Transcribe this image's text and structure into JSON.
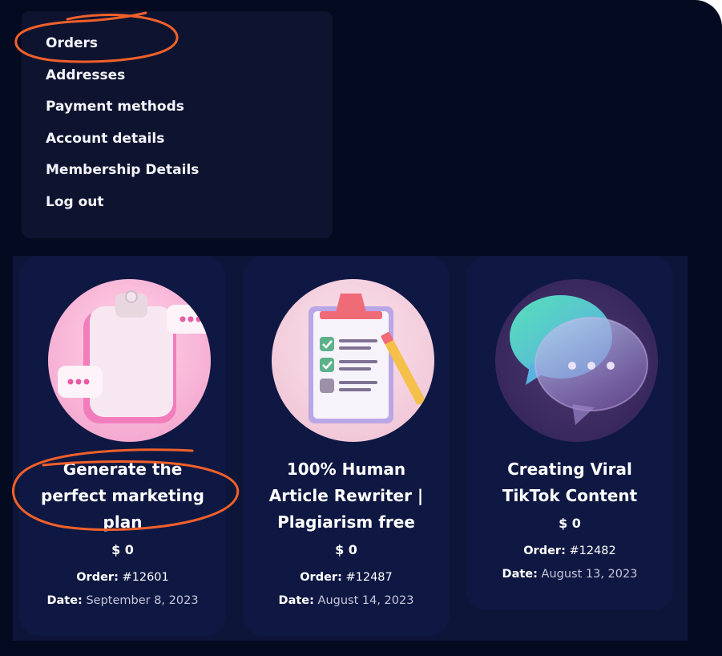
{
  "menu": {
    "items": [
      {
        "label": "Orders"
      },
      {
        "label": "Addresses"
      },
      {
        "label": "Payment methods"
      },
      {
        "label": "Account details"
      },
      {
        "label": "Membership Details"
      },
      {
        "label": "Log out"
      }
    ]
  },
  "orders": [
    {
      "title_lines": [
        "Generate the",
        "perfect marketing",
        "plan"
      ],
      "price": "$ 0",
      "order_label": "Order:",
      "order_number": "#12601",
      "date_label": "Date:",
      "date": "September 8, 2023",
      "image_icon": "clipboard-chat-bubbles-icon"
    },
    {
      "title_lines": [
        "100% Human",
        "Article Rewriter |",
        "Plagiarism free"
      ],
      "price": "$ 0",
      "order_label": "Order:",
      "order_number": "#12487",
      "date_label": "Date:",
      "date": "August 14, 2023",
      "image_icon": "checklist-clipboard-icon"
    },
    {
      "title_lines": [
        "Creating Viral",
        "TikTok Content"
      ],
      "price": "$ 0",
      "order_label": "Order:",
      "order_number": "#12482",
      "date_label": "Date:",
      "date": "August 13, 2023",
      "image_icon": "speech-bubbles-icon"
    }
  ],
  "colors": {
    "background": "#040a1f",
    "menu_panel": "#0e1430",
    "card": "#0f1843",
    "annotation": "#f0602a"
  }
}
